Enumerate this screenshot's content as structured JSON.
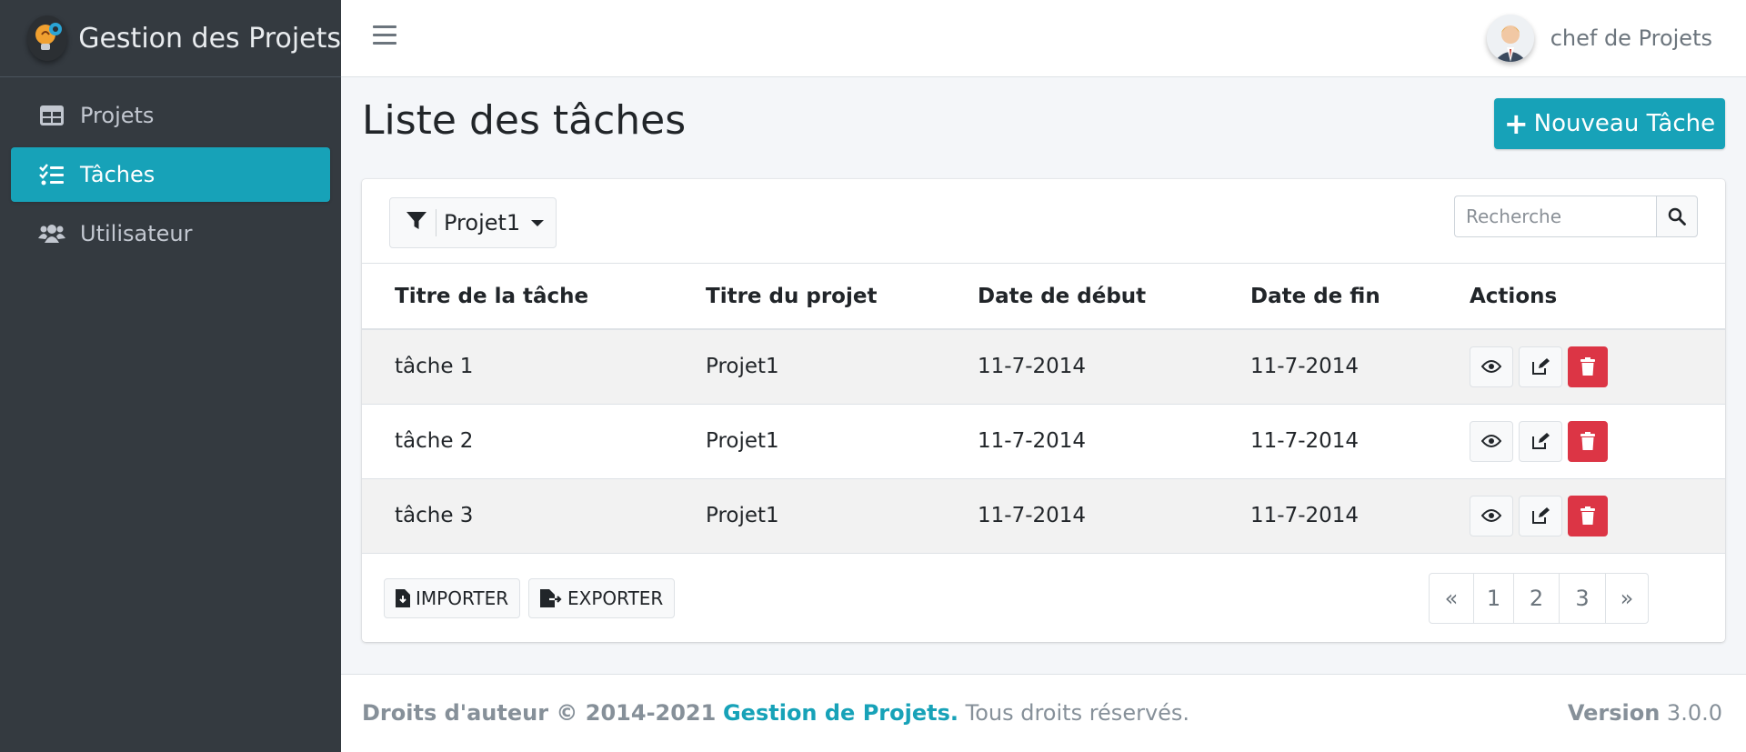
{
  "app": {
    "brand": "Gestion des Projets"
  },
  "sidebar": {
    "items": [
      {
        "label": "Projets",
        "icon": "table-icon",
        "active": false
      },
      {
        "label": "Tâches",
        "icon": "tasks-list-icon",
        "active": true
      },
      {
        "label": "Utilisateur",
        "icon": "users-icon",
        "active": false
      }
    ]
  },
  "topbar": {
    "user_name": "chef de Projets"
  },
  "page": {
    "title": "Liste des tâches",
    "new_button": "Nouveau Tâche"
  },
  "filter": {
    "selected": "Projet1"
  },
  "search": {
    "placeholder": "Recherche"
  },
  "table": {
    "columns": [
      "Titre de la tâche",
      "Titre du projet",
      "Date de début",
      "Date de fin",
      "Actions"
    ],
    "rows": [
      {
        "task": "tâche 1",
        "project": "Projet1",
        "start": "11-7-2014",
        "end": "11-7-2014"
      },
      {
        "task": "tâche 2",
        "project": "Projet1",
        "start": "11-7-2014",
        "end": "11-7-2014"
      },
      {
        "task": "tâche 3",
        "project": "Projet1",
        "start": "11-7-2014",
        "end": "11-7-2014"
      }
    ]
  },
  "footer_actions": {
    "import_label": "IMPORTER",
    "export_label": "EXPORTER"
  },
  "pagination": {
    "prev": "«",
    "pages": [
      "1",
      "2",
      "3"
    ],
    "next": "»"
  },
  "footer": {
    "copyright_prefix": "Droits d'auteur © 2014-2021",
    "brand_link": "Gestion de Projets.",
    "rights": "Tous droits réservés.",
    "version_label": "Version",
    "version_number": "3.0.0"
  },
  "colors": {
    "accent": "#17a2b8",
    "danger": "#dc3545",
    "sidebar_bg": "#343a40"
  }
}
